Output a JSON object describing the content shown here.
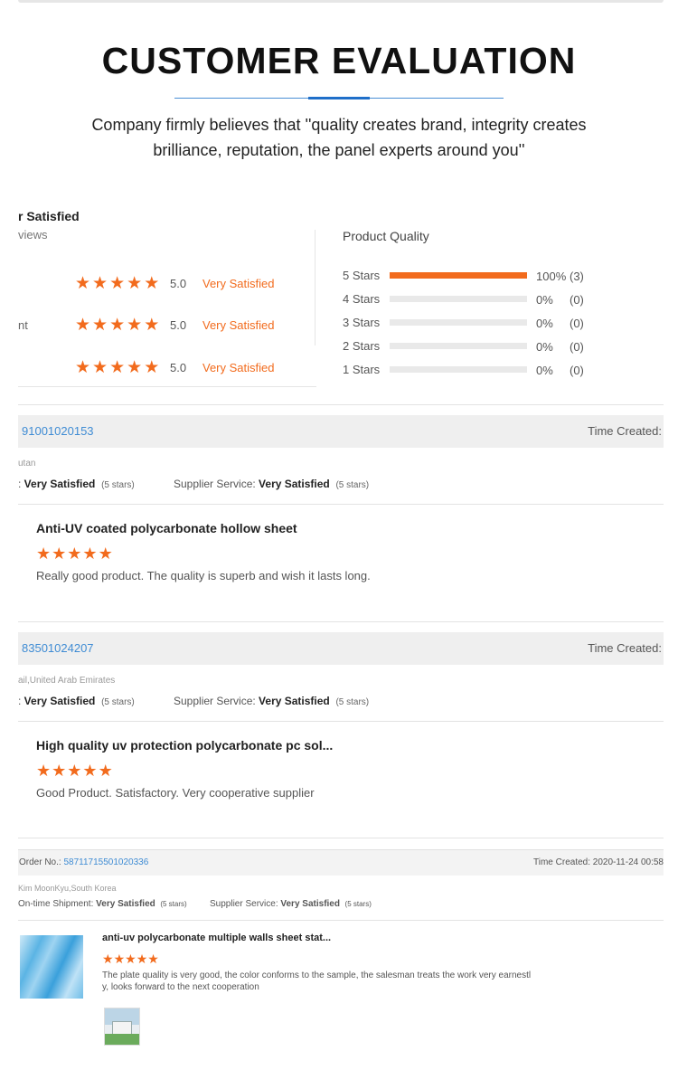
{
  "header": {
    "title": "CUSTOMER EVALUATION",
    "subtitle_line1": "Company firmly believes that ''quality creates brand, integrity creates",
    "subtitle_line2": "brilliance, reputation, the panel experts around you''"
  },
  "summary": {
    "title": "r Satisfied",
    "reviews": "views",
    "rows": [
      {
        "label": "",
        "score": "5.0",
        "text": "Very Satisfied",
        "stars": 5
      },
      {
        "label": "nt",
        "score": "5.0",
        "text": "Very Satisfied",
        "stars": 5
      },
      {
        "label": "",
        "score": "5.0",
        "text": "Very Satisfied",
        "stars": 5
      }
    ]
  },
  "product_quality": {
    "title": "Product Quality",
    "rows": [
      {
        "label": "5 Stars",
        "fraction": 1.0,
        "pct": "100%",
        "count": "(3)"
      },
      {
        "label": "4 Stars",
        "fraction": 0,
        "pct": "0%",
        "count": "(0)"
      },
      {
        "label": "3 Stars",
        "fraction": 0,
        "pct": "0%",
        "count": "(0)"
      },
      {
        "label": "2 Stars",
        "fraction": 0,
        "pct": "0%",
        "count": "(0)"
      },
      {
        "label": "1 Stars",
        "fraction": 0,
        "pct": "0%",
        "count": "(0)"
      }
    ]
  },
  "reviews": [
    {
      "order_no": "91001020153",
      "time_label": "Time Created:",
      "buyer": "utan",
      "metric1_label": ": ",
      "metric1_value": "Very Satisfied",
      "metric1_stars": "(5 stars)",
      "metric2_label": "Supplier Service: ",
      "metric2_value": "Very Satisfied",
      "metric2_stars": "(5 stars)",
      "product": "Anti-UV coated polycarbonate hollow sheet",
      "rating": 5,
      "comment": "Really good product. The quality is superb and wish it lasts long."
    },
    {
      "order_no": "83501024207",
      "time_label": "Time Created:",
      "buyer": "ail,United Arab Emirates",
      "metric1_label": ": ",
      "metric1_value": "Very Satisfied",
      "metric1_stars": "(5 stars)",
      "metric2_label": "Supplier Service: ",
      "metric2_value": "Very Satisfied",
      "metric2_stars": "(5 stars)",
      "product": "High quality uv protection polycarbonate pc sol...",
      "rating": 5,
      "comment": "Good Product. Satisfactory. Very cooperative supplier"
    },
    {
      "order_label": "Order No.: ",
      "order_no": "58711715501020336",
      "time_label": "Time Created: 2020-11-24 00:58",
      "buyer": "Kim MoonKyu,South Korea",
      "metric1_label": "On-time Shipment: ",
      "metric1_value": "Very Satisfied",
      "metric1_stars": "(5 stars)",
      "metric2_label": "Supplier Service: ",
      "metric2_value": "Very Satisfied",
      "metric2_stars": "(5 stars)",
      "product": "anti-uv polycarbonate multiple walls sheet stat...",
      "rating": 5,
      "comment_line1": "The plate quality is very good, the color conforms to the sample, the salesman treats the work very earnestl",
      "comment_line2": "y, looks forward to the next cooperation"
    }
  ],
  "colors": {
    "accent": "#f26b1d",
    "link": "#3f8cd4",
    "rule": "#1f6fc9"
  },
  "icons": {
    "star": "star-icon"
  }
}
